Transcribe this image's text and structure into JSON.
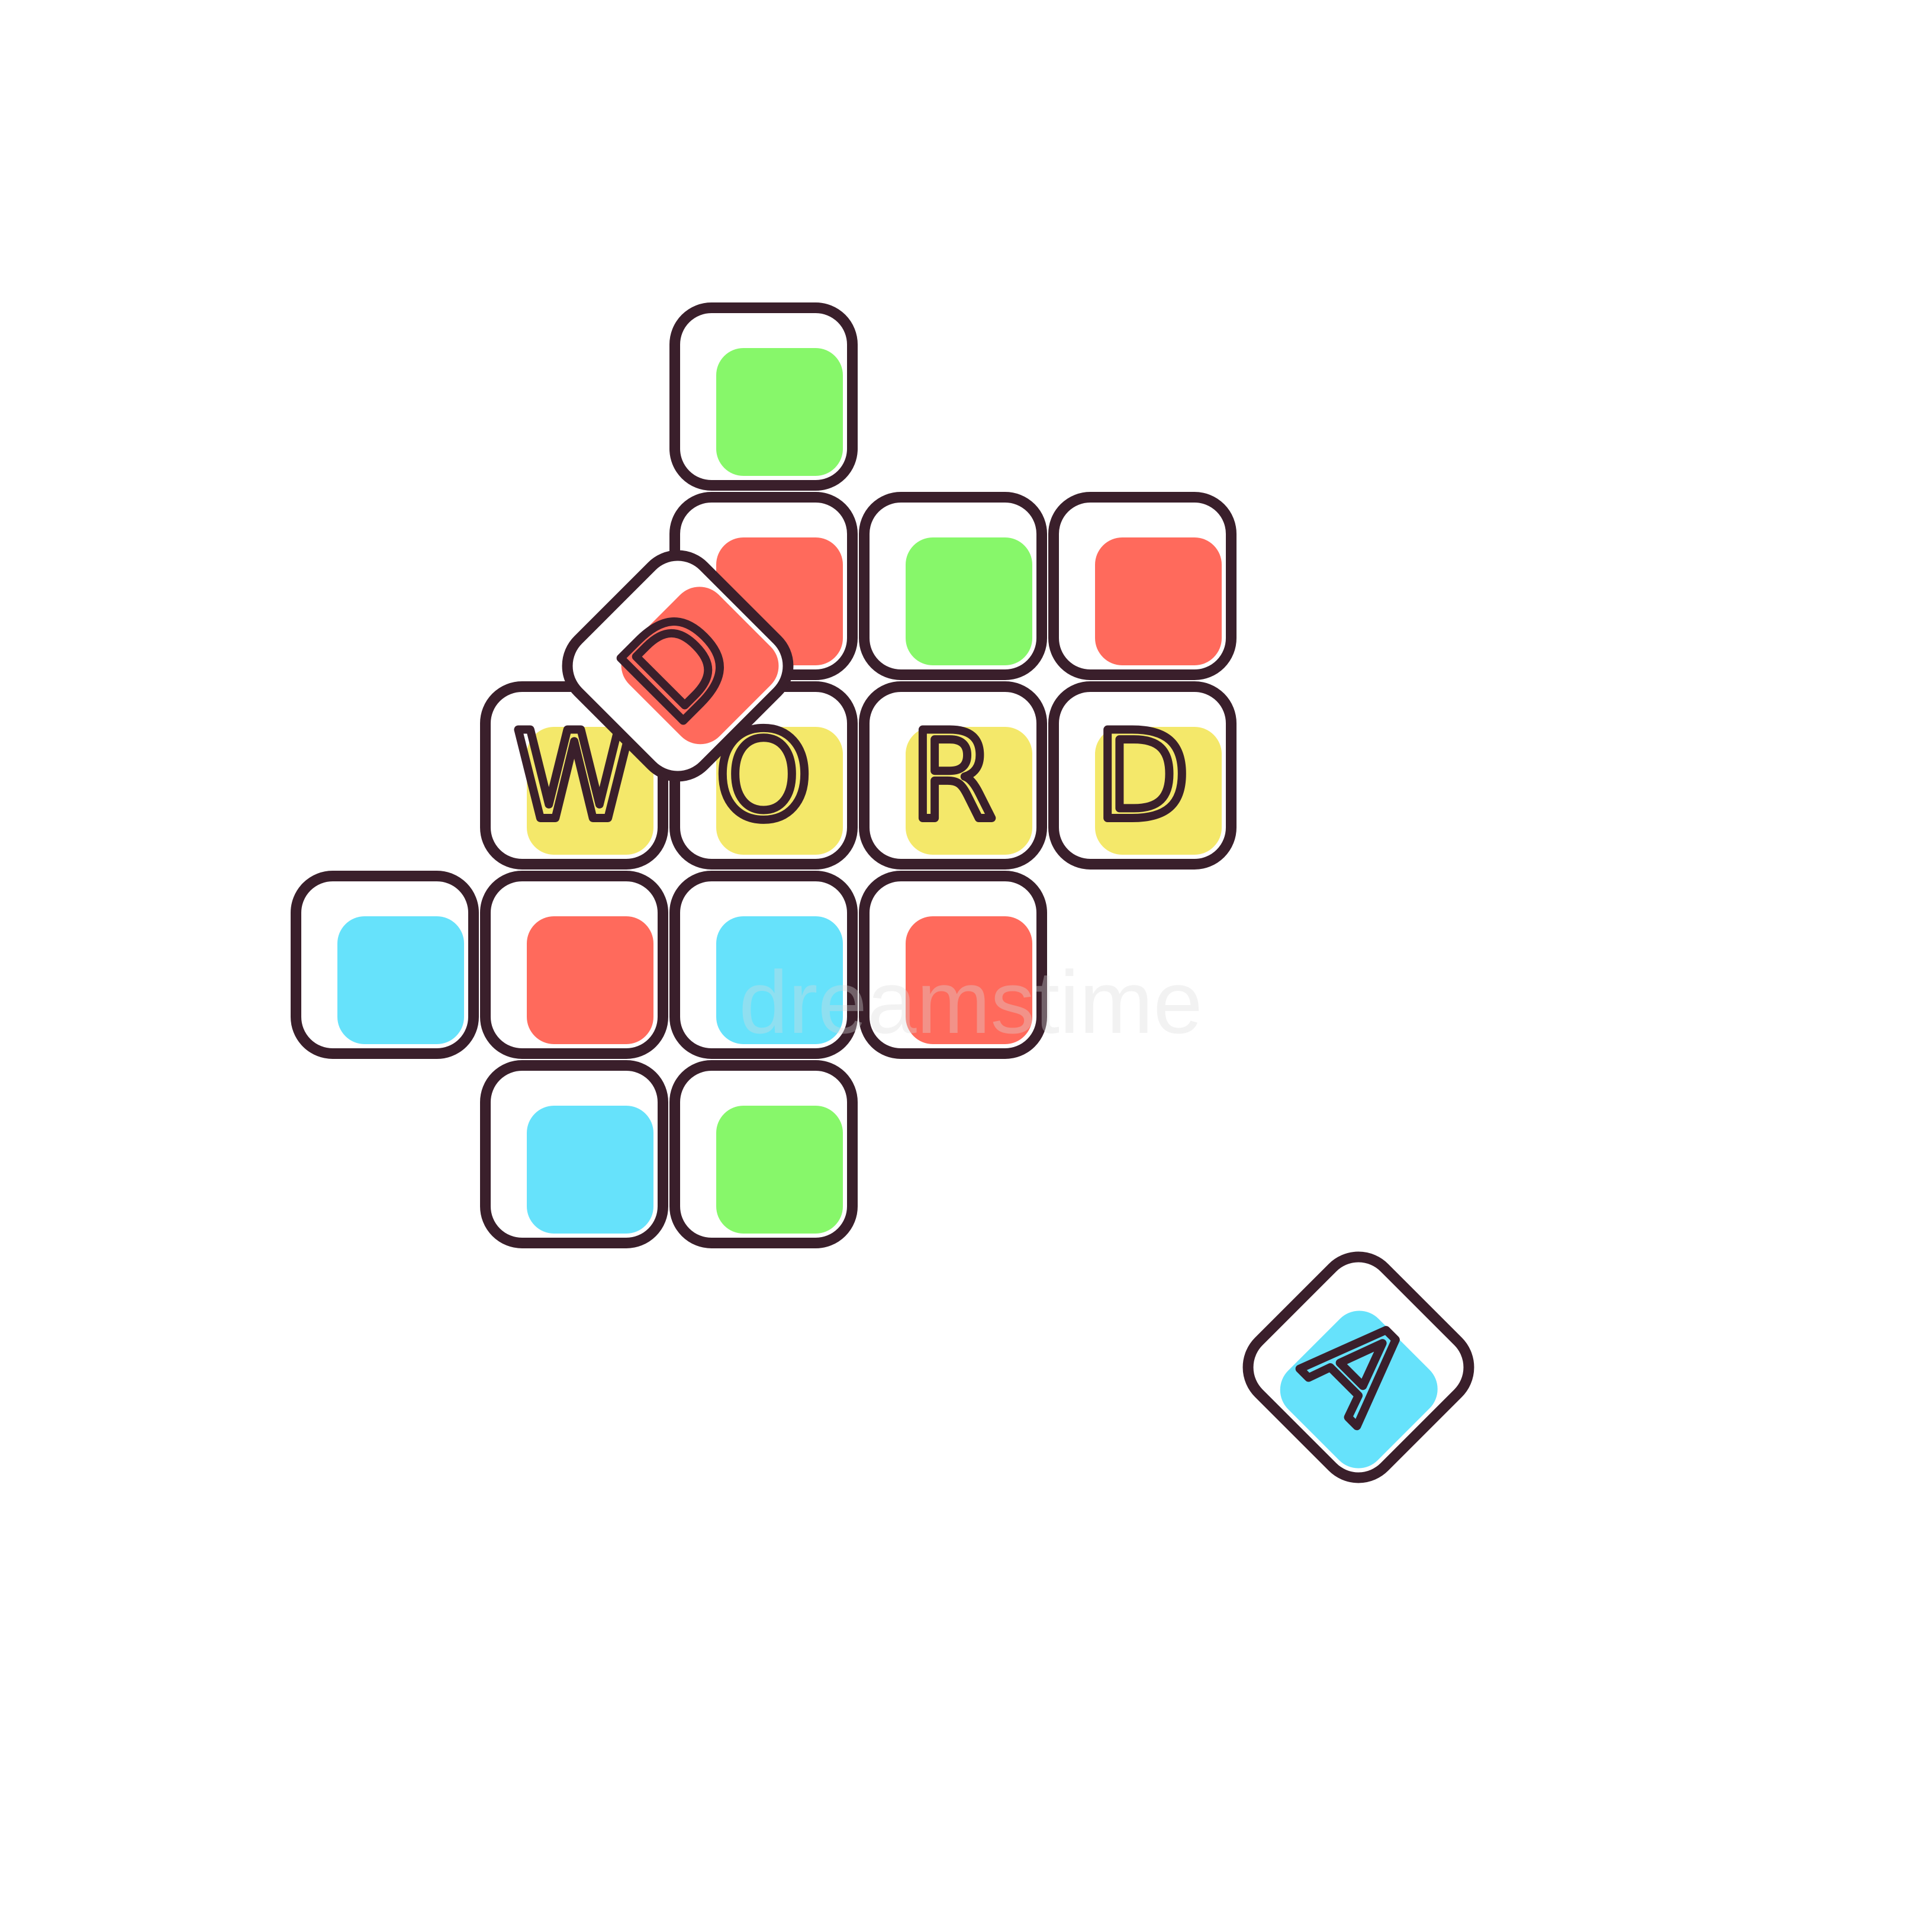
{
  "colors": {
    "outline": "#3a1f2b",
    "red": "#ff6a5c",
    "green": "#87f76a",
    "blue": "#66e2fb",
    "yellow": "#f4e86a",
    "tile_face": "#ffffff"
  },
  "word_tiles": [
    "W",
    "O",
    "R",
    "D"
  ],
  "loose_tiles": [
    "D",
    "A"
  ],
  "watermark": "dreamstime"
}
